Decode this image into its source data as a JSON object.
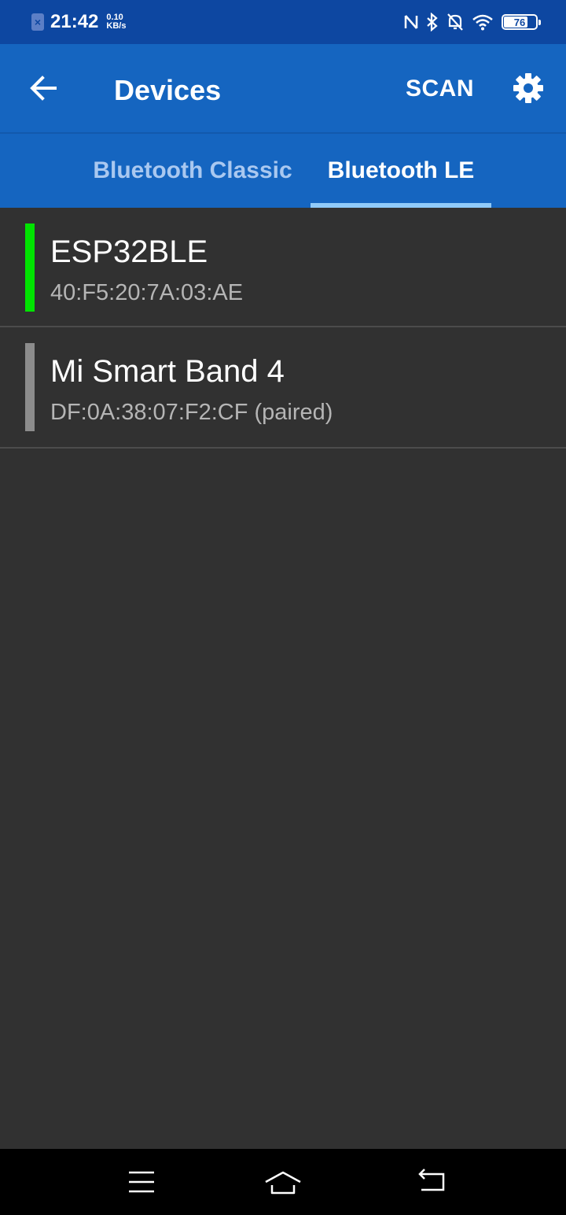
{
  "status_bar": {
    "time": "21:42",
    "net_speed_value": "0.10",
    "net_speed_unit": "KB/s",
    "sim_icon": "sim-error-icon",
    "icons": [
      "nfc-icon",
      "bluetooth-icon",
      "notifications-off-icon",
      "wifi-icon"
    ],
    "battery_level": "76"
  },
  "app_bar": {
    "title": "Devices",
    "scan_label": "SCAN",
    "back_icon": "arrow-back-icon",
    "settings_icon": "gear-icon"
  },
  "tabs": [
    {
      "label": "Bluetooth Classic",
      "selected": false
    },
    {
      "label": "Bluetooth LE",
      "selected": true
    }
  ],
  "devices": [
    {
      "name": "ESP32BLE",
      "address": "40:F5:20:7A:03:AE",
      "status_color": "#00e300"
    },
    {
      "name": "Mi Smart Band 4",
      "address": "DF:0A:38:07:F2:CF (paired)",
      "status_color": "#8c8c8c"
    }
  ],
  "colors": {
    "status_bar": "#0d47a1",
    "app_bar": "#1565c0",
    "tab_indicator": "#90caf9",
    "background": "#313131"
  },
  "nav_bar": {
    "icons": [
      "menu-icon",
      "home-icon",
      "back-icon"
    ]
  }
}
